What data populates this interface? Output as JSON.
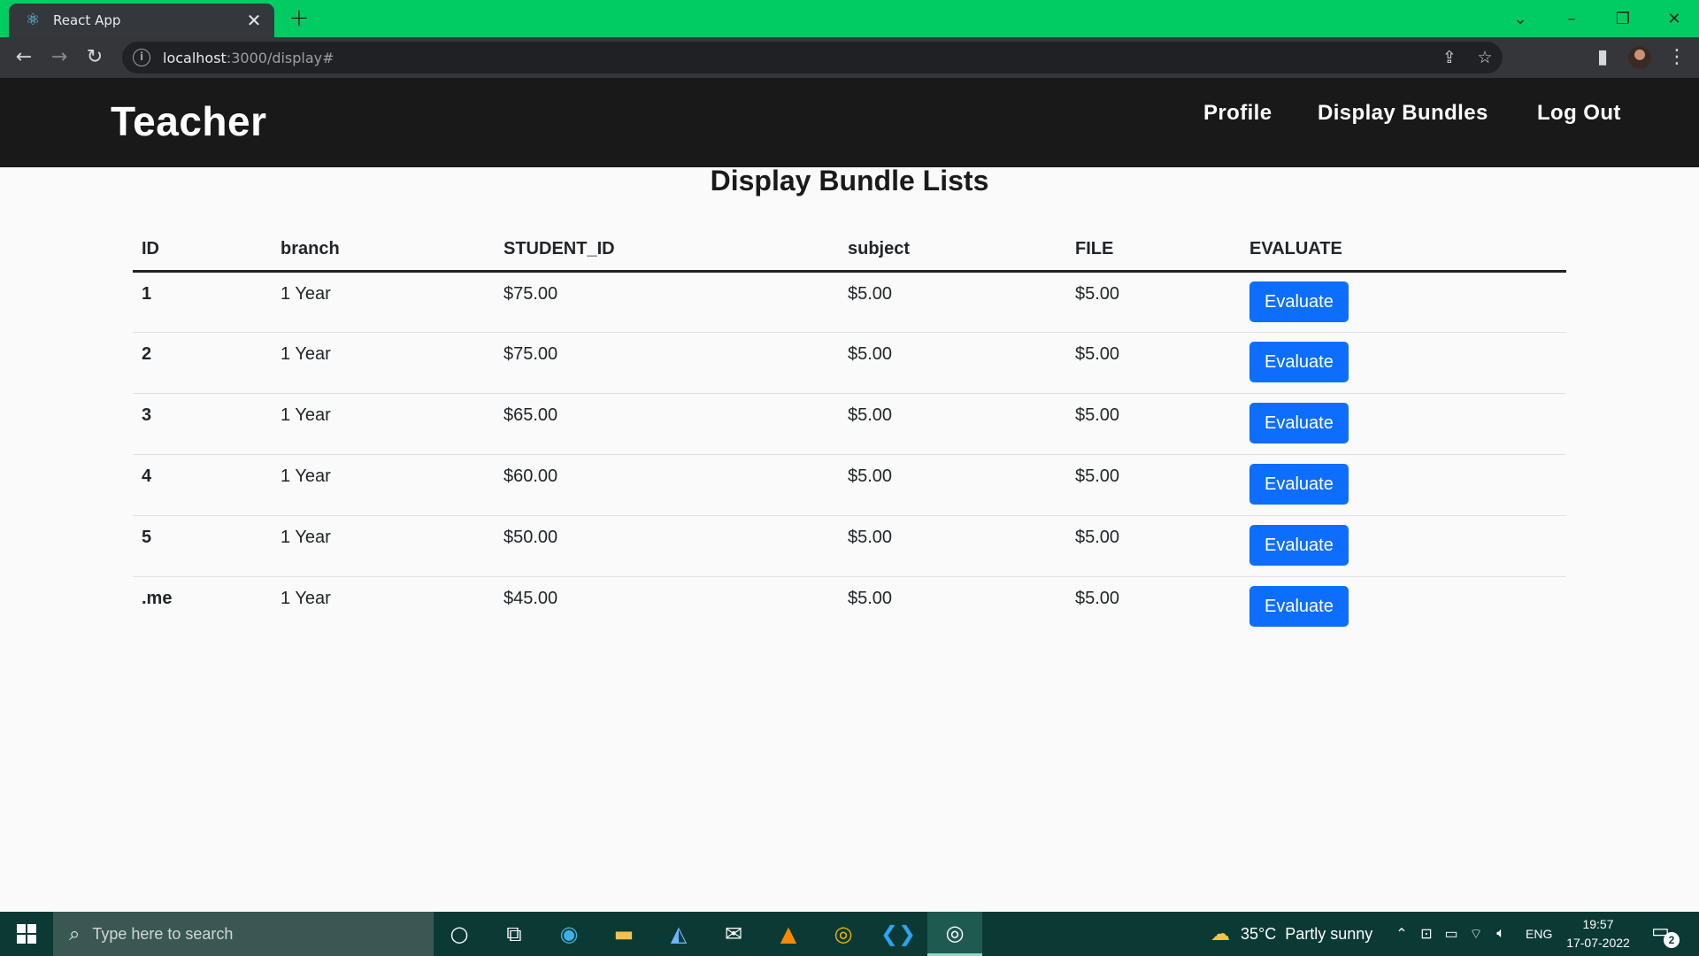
{
  "browser": {
    "tab_title": "React App",
    "tab_icon": "react-icon",
    "url_host": "localhost",
    "url_rest": ":3000/display#",
    "tabstrip_color": "#00cc63"
  },
  "header": {
    "brand": "Teacher",
    "nav": [
      {
        "label": "Profile"
      },
      {
        "label": "Display Bundles"
      },
      {
        "label": "Log Out"
      }
    ]
  },
  "main": {
    "title": "Display Bundle Lists",
    "columns": [
      "ID",
      "branch",
      "STUDENT_ID",
      "subject",
      "FILE",
      "EVALUATE"
    ],
    "rows": [
      {
        "id": "1",
        "branch": "1 Year",
        "student_id": "$75.00",
        "subject": "$5.00",
        "file": "$5.00",
        "action": "Evaluate"
      },
      {
        "id": "2",
        "branch": "1 Year",
        "student_id": "$75.00",
        "subject": "$5.00",
        "file": "$5.00",
        "action": "Evaluate"
      },
      {
        "id": "3",
        "branch": "1 Year",
        "student_id": "$65.00",
        "subject": "$5.00",
        "file": "$5.00",
        "action": "Evaluate"
      },
      {
        "id": "4",
        "branch": "1 Year",
        "student_id": "$60.00",
        "subject": "$5.00",
        "file": "$5.00",
        "action": "Evaluate"
      },
      {
        "id": "5",
        "branch": "1 Year",
        "student_id": "$50.00",
        "subject": "$5.00",
        "file": "$5.00",
        "action": "Evaluate"
      },
      {
        "id": ".me",
        "branch": "1 Year",
        "student_id": "$45.00",
        "subject": "$5.00",
        "file": "$5.00",
        "action": "Evaluate"
      }
    ],
    "button_color": "#0d6efd"
  },
  "taskbar": {
    "search_placeholder": "Type here to search",
    "weather": "35°C  Partly sunny",
    "language": "ENG",
    "time": "19:57",
    "date": "17-07-2022",
    "notification_count": "2"
  }
}
